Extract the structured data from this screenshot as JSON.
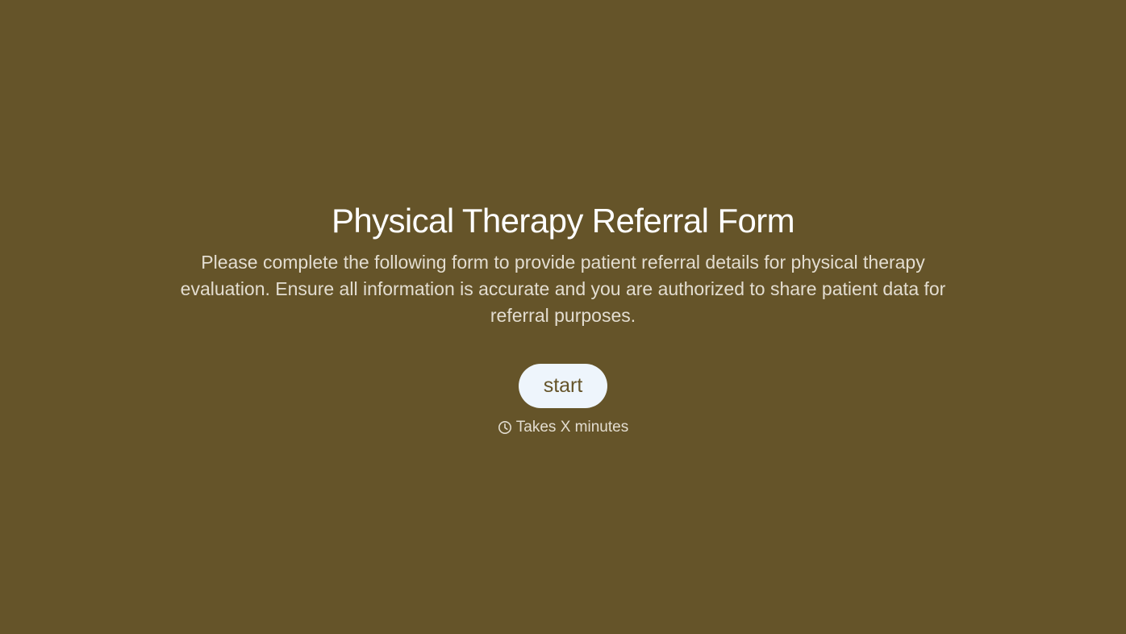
{
  "colors": {
    "background": "#655429",
    "title_text": "#ffffff",
    "body_text": "#e3ddd0",
    "button_background": "#eef5fc",
    "button_text": "#655429"
  },
  "intro": {
    "title": "Physical Therapy Referral Form",
    "description": "Please complete the following form to provide patient referral details for physical therapy evaluation. Ensure all information is accurate and you are authorized to share patient data for referral purposes.",
    "start_label": "start",
    "duration_icon": "clock-icon",
    "duration_text": "Takes X minutes"
  }
}
